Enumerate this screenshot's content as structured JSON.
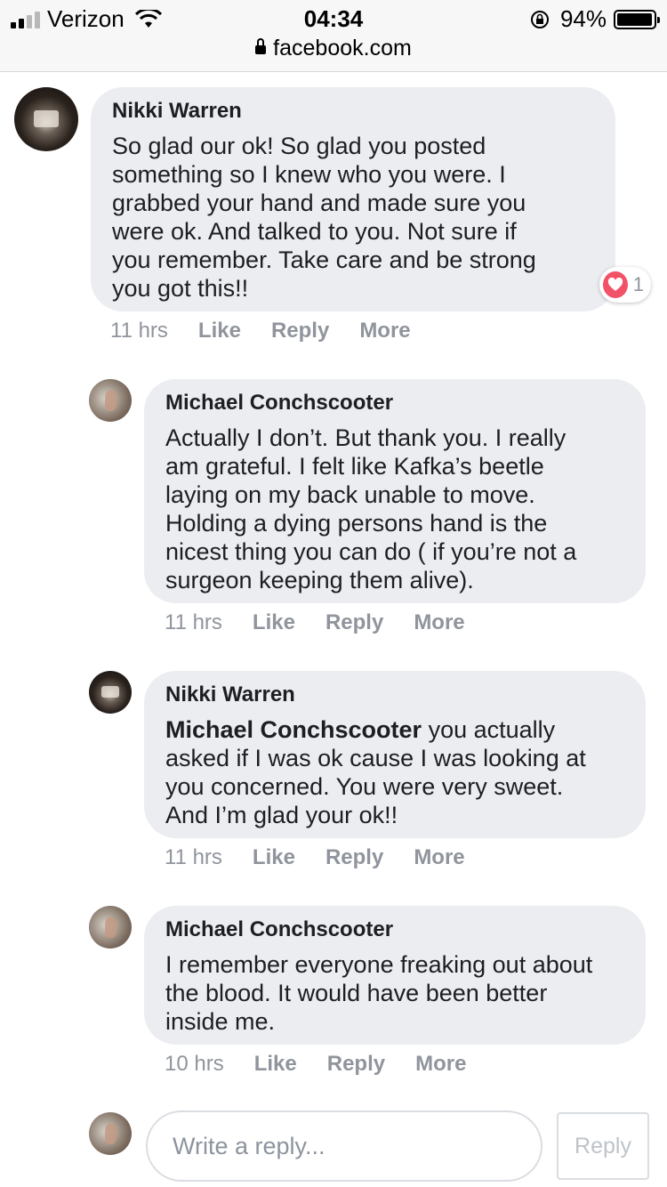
{
  "status_bar": {
    "carrier": "Verizon",
    "time": "04:34",
    "battery": "94%",
    "url": "facebook.com"
  },
  "comments": [
    {
      "author": "Nikki Warren",
      "text": "So glad our ok! So glad you posted\nsomething so I knew who you were. I\ngrabbed your hand and made sure you\nwere ok. And talked to you. Not sure if\nyou remember. Take care and be strong\nyou got this!!",
      "time": "11 hrs",
      "like": "Like",
      "reply": "Reply",
      "more": "More",
      "reaction_count": "1"
    },
    {
      "author": "Michael Conchscooter",
      "text": "Actually I don’t. But thank you. I really\nam grateful. I felt like Kafka’s beetle\nlaying on my back unable to move.\nHolding a dying persons hand is the\nnicest thing you can do ( if you’re not a\nsurgeon keeping them alive).",
      "time": "11 hrs",
      "like": "Like",
      "reply": "Reply",
      "more": "More"
    },
    {
      "author": "Nikki Warren",
      "mention": "Michael Conchscooter",
      "text": " you actually\nasked if I was ok cause I was looking at\nyou concerned. You were very sweet.\nAnd I’m glad your ok!!",
      "time": "11 hrs",
      "like": "Like",
      "reply": "Reply",
      "more": "More"
    },
    {
      "author": "Michael Conchscooter",
      "text": "I remember everyone freaking out about\nthe blood. It would have been better\ninside me.",
      "time": "10 hrs",
      "like": "Like",
      "reply": "Reply",
      "more": "More"
    }
  ],
  "reply_box": {
    "placeholder": "Write a reply...",
    "button": "Reply"
  },
  "icons": {
    "signal": "signal-bars-icon",
    "wifi": "wifi-icon",
    "rotation_lock": "rotation-lock-icon",
    "battery": "battery-icon",
    "lock": "lock-icon",
    "heart": "heart-reaction-icon"
  },
  "colors": {
    "bubble": "#ebedf0",
    "meta_text": "#90949c",
    "heart": "#f25268"
  }
}
